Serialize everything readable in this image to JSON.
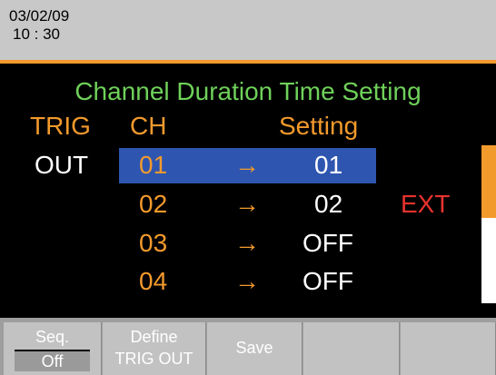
{
  "status": {
    "date": "03/02/09",
    "time": "10 : 30"
  },
  "screen": {
    "title": "Channel Duration Time Setting",
    "headers": {
      "trig": "TRIG",
      "ch": "CH",
      "setting": "Setting"
    },
    "trig_value": "OUT",
    "rows": [
      {
        "ch": "01",
        "arrow": "→",
        "setting": "01",
        "selected": true
      },
      {
        "ch": "02",
        "arrow": "→",
        "setting": "02",
        "extra": "EXT"
      },
      {
        "ch": "03",
        "arrow": "→",
        "setting": "OFF"
      },
      {
        "ch": "04",
        "arrow": "→",
        "setting": "OFF"
      }
    ]
  },
  "softkeys": {
    "seq_label": "Seq.",
    "seq_value": "Off",
    "define_line1": "Define",
    "define_line2": "TRIG OUT",
    "save_label": "Save"
  },
  "colors": {
    "accent": "#f39a2c",
    "title": "#6fd15a",
    "selection": "#2e56b0",
    "ext": "#e8322d"
  }
}
